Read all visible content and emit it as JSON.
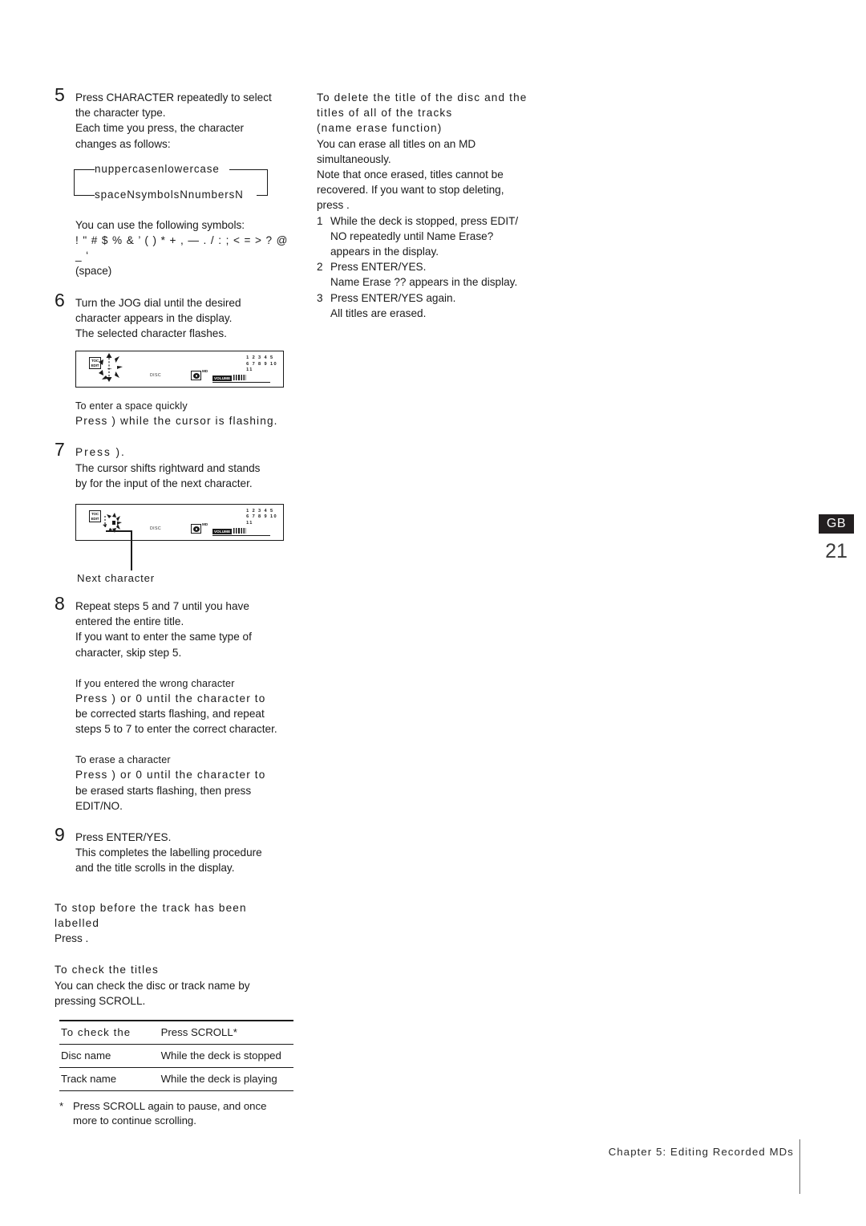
{
  "page": {
    "number": "21",
    "region_badge": "GB",
    "footer": "Chapter 5: Editing Recorded MDs"
  },
  "left_column": {
    "step5": {
      "number": "5",
      "lines": [
        "Press CHARACTER repeatedly to select",
        "the character type.",
        "Each time you press, the character",
        "changes as follows:"
      ],
      "cycle_diagram": {
        "top_row": "nuppercasenlowercase",
        "bottom_row": "spaceNsymbolsNnumbersN"
      },
      "symbols_intro": "You can use the following symbols:",
      "symbols_line": "! \" # $ % & ’ ( ) * + , — . / : ; < = > ? @ _ ‘",
      "symbols_space": "(space)"
    },
    "step6": {
      "number": "6",
      "lines": [
        "Turn the JOG dial until the desired",
        "character appears in the display.",
        "The selected character flashes."
      ],
      "display": {
        "toc_label_line1": "TOC",
        "toc_label_line2": "EDIT",
        "disc_label": "DISC",
        "md_superscript": "MD",
        "volume_label": "VOLUME",
        "track_rows": [
          "1 2 3 4 5",
          "6 7 8 9 10",
          "11"
        ]
      }
    },
    "space_tip": {
      "heading": "To enter a space quickly",
      "body": "Press ) while the cursor is flashing."
    },
    "step7": {
      "number": "7",
      "heading": "Press ).",
      "lines": [
        "The cursor shifts rightward and stands",
        "by for the input of the next character."
      ],
      "display": {
        "toc_label_line1": "TOC",
        "toc_label_line2": "EDIT",
        "disc_label": "DISC",
        "md_superscript": "MD",
        "volume_label": "VOLUME",
        "track_rows": [
          "1 2 3 4 5",
          "6 7 8 9 10",
          "11"
        ]
      },
      "callout": "Next character"
    },
    "step8": {
      "number": "8",
      "lines": [
        "Repeat steps 5 and 7 until you have",
        "entered the entire title.",
        "If you want to enter the same type of",
        "character, skip step 5."
      ]
    },
    "wrong_char_tip": {
      "heading": "If you entered the wrong character",
      "line1": "Press ) or 0  until the character to",
      "lines": [
        "be corrected starts flashing, and repeat",
        "steps 5 to 7 to enter the correct character."
      ]
    },
    "erase_char_tip": {
      "heading": "To erase a character",
      "line1": "Press ) or 0 until the character to",
      "lines": [
        "be erased starts flashing, then press",
        "EDIT/NO."
      ]
    },
    "step9": {
      "number": "9",
      "lines": [
        "Press ENTER/YES.",
        "This completes the labelling procedure",
        "and the title scrolls in the display."
      ]
    },
    "stop_tip": {
      "heading_line1": "To stop before the track has been",
      "heading_line2": "labelled",
      "body": "Press  ."
    },
    "check_titles": {
      "heading": "To check the titles",
      "lines": [
        "You can check the disc or track name by",
        "pressing SCROLL."
      ],
      "table": {
        "headers": [
          "To check the",
          "Press SCROLL*"
        ],
        "rows": [
          [
            "Disc name",
            "While the deck is stopped"
          ],
          [
            "Track name",
            "While the deck is playing"
          ]
        ]
      },
      "footnote_marker": "*",
      "footnote_lines": [
        "Press SCROLL again to pause, and once",
        "more to continue scrolling."
      ]
    }
  },
  "right_column": {
    "name_erase": {
      "heading_line1": "To delete the title of the disc and the",
      "heading_line2": "titles of all of the tracks",
      "heading_line3": "(name erase function)",
      "lines": [
        "You can erase all titles on an MD",
        "simultaneously.",
        "Note that once erased, titles cannot be",
        "recovered. If you want to stop deleting,",
        "press  ."
      ],
      "steps": [
        {
          "number": "1",
          "lines": [
            "While the deck is stopped, press EDIT/",
            "NO repeatedly until  Name Erase?",
            "appears in the display."
          ]
        },
        {
          "number": "2",
          "lines": [
            "Press ENTER/YES.",
            " Name Erase ??  appears in the display."
          ]
        },
        {
          "number": "3",
          "lines": [
            "Press ENTER/YES again.",
            "All titles are erased."
          ]
        }
      ]
    }
  },
  "colors": {
    "text": "#1a1a1a",
    "badge_bg": "#231f20",
    "badge_text": "#ffffff",
    "page_num": "#3a3a3a"
  }
}
